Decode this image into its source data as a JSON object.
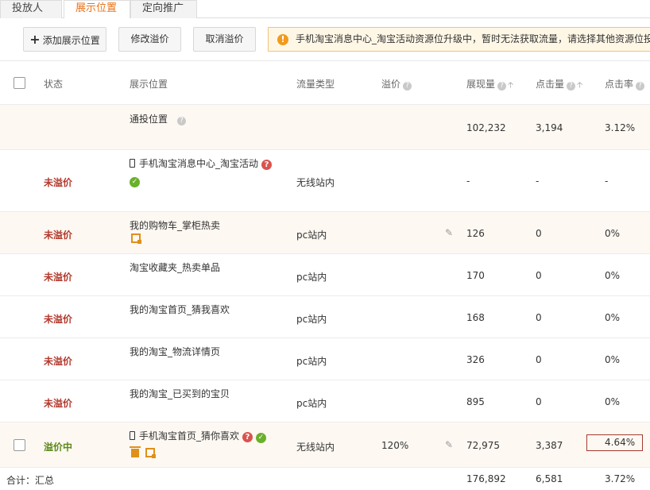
{
  "tabs": [
    "投放人群",
    "展示位置",
    "定向推广"
  ],
  "toolbar": {
    "add_label": "添加展示位置",
    "edit_label": "修改溢价",
    "cancel_label": "取消溢价",
    "notice": "手机淘宝消息中心_淘宝活动资源位升级中，暂时无法获取流量，请选择其他资源位投放"
  },
  "columns": {
    "status": "状态",
    "position": "展示位置",
    "traffic": "流量类型",
    "premium": "溢价",
    "impressions": "展现量",
    "clicks": "点击量",
    "ctr": "点击率"
  },
  "rows": [
    {
      "status": "",
      "position": "通投位置",
      "traffic": "",
      "premium": "",
      "impressions": "102,232",
      "clicks": "3,194",
      "ctr": "3.12%"
    },
    {
      "status": "未溢价",
      "position": "手机淘宝消息中心_淘宝活动",
      "traffic": "无线站内",
      "premium": "",
      "impressions": "-",
      "clicks": "-",
      "ctr": "-"
    },
    {
      "status": "未溢价",
      "position": "我的购物车_掌柜热卖",
      "traffic": "pc站内",
      "premium": "",
      "impressions": "126",
      "clicks": "0",
      "ctr": "0%"
    },
    {
      "status": "未溢价",
      "position": "淘宝收藏夹_热卖单品",
      "traffic": "pc站内",
      "premium": "",
      "impressions": "170",
      "clicks": "0",
      "ctr": "0%"
    },
    {
      "status": "未溢价",
      "position": "我的淘宝首页_猜我喜欢",
      "traffic": "pc站内",
      "premium": "",
      "impressions": "168",
      "clicks": "0",
      "ctr": "0%"
    },
    {
      "status": "未溢价",
      "position": "我的淘宝_物流详情页",
      "traffic": "pc站内",
      "premium": "",
      "impressions": "326",
      "clicks": "0",
      "ctr": "0%"
    },
    {
      "status": "未溢价",
      "position": "我的淘宝_已买到的宝贝",
      "traffic": "pc站内",
      "premium": "",
      "impressions": "895",
      "clicks": "0",
      "ctr": "0%"
    },
    {
      "status": "溢价中",
      "position": "手机淘宝首页_猜你喜欢",
      "traffic": "无线站内",
      "premium": "120%",
      "impressions": "72,975",
      "clicks": "3,387",
      "ctr": "4.64%"
    }
  ],
  "total": {
    "label": "合计：汇总",
    "impressions": "176,892",
    "clicks": "6,581",
    "ctr": "3.72%"
  },
  "icons": {
    "help": "question-icon",
    "warning": "warning-icon",
    "phone": "phone-icon",
    "check": "check-icon",
    "edit": "pencil-icon",
    "trash": "trash-icon",
    "monitor": "monitor-icon"
  },
  "colors": {
    "accent": "#e8731a",
    "status_no": "#b33a2e",
    "status_yes": "#5a8a1a",
    "notice_bg": "#fff7e6"
  }
}
